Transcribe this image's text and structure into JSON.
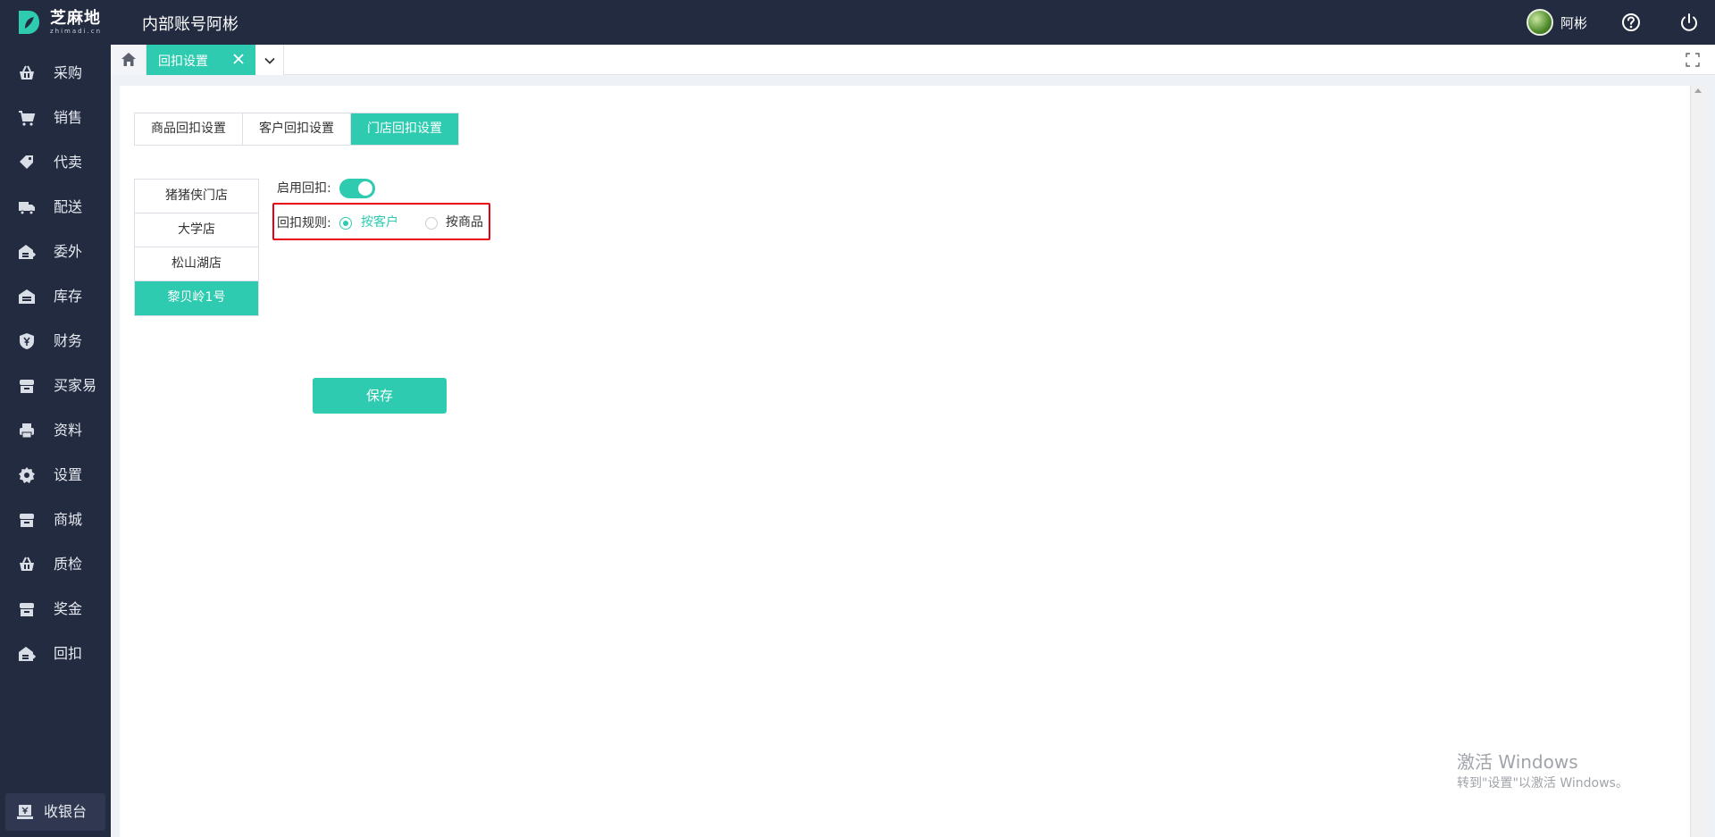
{
  "header": {
    "logo_name": "芝麻地",
    "logo_sub": "zhimadi.cn",
    "account_title": "内部账号阿彬",
    "user_name": "阿彬"
  },
  "sidebar": {
    "items": [
      {
        "label": "采购",
        "icon": "basket-icon"
      },
      {
        "label": "销售",
        "icon": "cart-icon"
      },
      {
        "label": "代卖",
        "icon": "tag-icon"
      },
      {
        "label": "配送",
        "icon": "truck-icon"
      },
      {
        "label": "委外",
        "icon": "warehouse-export-icon"
      },
      {
        "label": "库存",
        "icon": "warehouse-icon"
      },
      {
        "label": "财务",
        "icon": "yen-shield-icon"
      },
      {
        "label": "买家易",
        "icon": "store-icon"
      },
      {
        "label": "资料",
        "icon": "printer-icon"
      },
      {
        "label": "设置",
        "icon": "gear-icon"
      },
      {
        "label": "商城",
        "icon": "shop-icon"
      },
      {
        "label": "质检",
        "icon": "basket-check-icon"
      },
      {
        "label": "奖金",
        "icon": "bonus-icon"
      },
      {
        "label": "回扣",
        "icon": "rebate-icon"
      }
    ],
    "cashier_label": "收银台"
  },
  "tabs": {
    "active_label": "回扣设置"
  },
  "settings": {
    "segments": [
      {
        "label": "商品回扣设置",
        "active": false
      },
      {
        "label": "客户回扣设置",
        "active": false
      },
      {
        "label": "门店回扣设置",
        "active": true
      }
    ],
    "stores": [
      {
        "label": "猪猪侠门店",
        "active": false
      },
      {
        "label": "大学店",
        "active": false
      },
      {
        "label": "松山湖店",
        "active": false
      },
      {
        "label": "黎贝岭1号",
        "active": true
      }
    ],
    "enable_label": "启用回扣:",
    "enable_value": true,
    "rule_label": "回扣规则:",
    "rule_options": [
      {
        "label": "按客户",
        "checked": true
      },
      {
        "label": "按商品",
        "checked": false
      }
    ],
    "save_label": "保存"
  },
  "watermark": {
    "line1": "激活 Windows",
    "line2": "转到\"设置\"以激活 Windows。"
  },
  "colors": {
    "accent": "#2ecbb0",
    "sidebar_bg": "#222b40",
    "highlight_border": "#e60012"
  }
}
